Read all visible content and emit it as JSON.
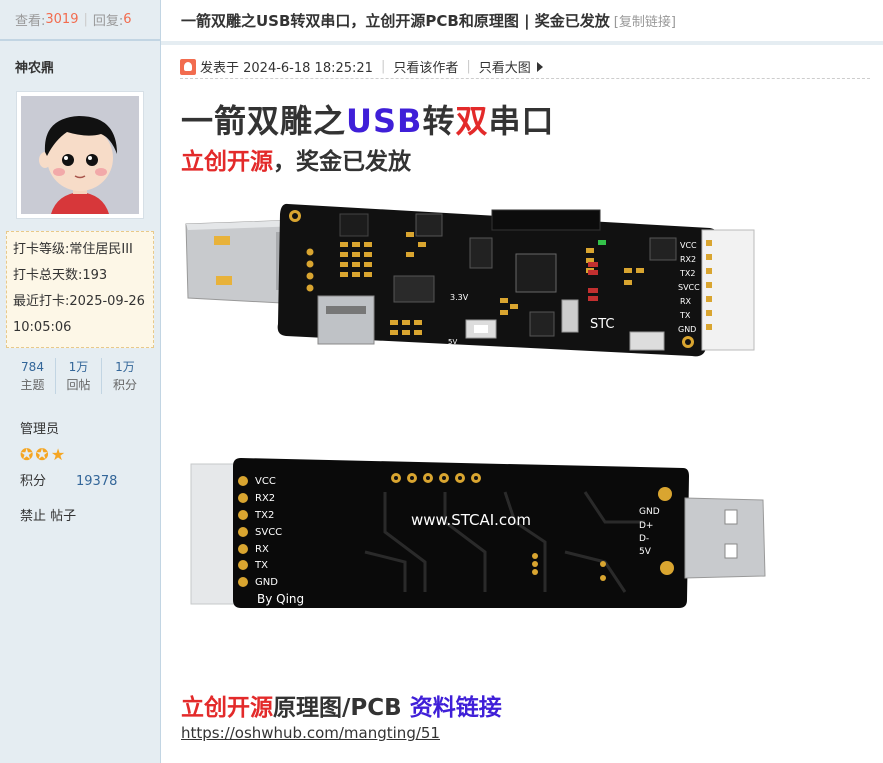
{
  "sidebar": {
    "views_label": "查看:",
    "views": "3019",
    "replies_label": "回复:",
    "replies": "6",
    "username": "神农鼎",
    "checkin": {
      "level_label": "打卡等级:",
      "level": "常住居民III",
      "days_label": "打卡总天数:",
      "days": "193",
      "last_label": "最近打卡:",
      "last": "2025-09-26 10:05:06"
    },
    "stats": [
      {
        "value": "784",
        "label": "主题"
      },
      {
        "value": "1万",
        "label": "回帖"
      },
      {
        "value": "1万",
        "label": "积分"
      }
    ],
    "role": "管理员",
    "points_label": "积分",
    "points": "19378",
    "ban": "禁止 帖子"
  },
  "thread": {
    "title": "一箭双雕之USB转双串口，立创开源PCB和原理图 | 奖金已发放",
    "copy_link": "[复制链接]"
  },
  "post": {
    "posted": "发表于 2024-6-18 18:25:21",
    "only_author": "只看该作者",
    "big_image": "只看大图",
    "heading": {
      "p1": "一箭双雕之",
      "p2": "USB",
      "p3": "转",
      "p4": "双",
      "p5": "串口"
    },
    "subheading": {
      "p1": "立创开源",
      "p2": "，奖金已发放"
    },
    "pcb_front": {
      "labels": [
        "VCC",
        "RX2",
        "TX2",
        "SVCC",
        "RX",
        "TX",
        "GND"
      ],
      "brand": "STC",
      "misc": "3.3V",
      "five_v": "5V"
    },
    "pcb_back": {
      "labels": [
        "VCC",
        "RX2",
        "TX2",
        "SVCC",
        "RX",
        "TX",
        "GND"
      ],
      "url": "www.STCAI.com",
      "author": "By Qing",
      "usb_labels": [
        "GND",
        "D+",
        "D-",
        "5V"
      ]
    },
    "resources": {
      "p1": "立创开源",
      "p2": "原理图/PCB ",
      "p3": "资料链接"
    },
    "link": "https://oshwhub.com/mangting/51"
  },
  "colors": {
    "accent_red": "#e32a2a",
    "accent_blue": "#3f1fd8",
    "sidebar_bg": "#e5edf2",
    "count_orange": "#f26c4f"
  }
}
